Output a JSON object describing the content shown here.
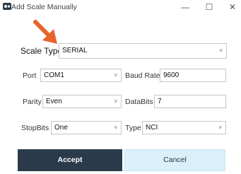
{
  "window": {
    "title": "Add Scale Manually",
    "minimize_glyph": "—",
    "maximize_glyph": "☐",
    "close_glyph": "✕"
  },
  "scale_type": {
    "label": "Scale Type",
    "value": "SERIAL"
  },
  "port": {
    "label": "Port",
    "value": "COM1"
  },
  "baud_rate": {
    "label": "Baud Rate",
    "value": "9600"
  },
  "parity": {
    "label": "Parity",
    "value": "Even"
  },
  "data_bits": {
    "label": "DataBits",
    "value": "7"
  },
  "stop_bits": {
    "label": "StopBits",
    "value": "One"
  },
  "type": {
    "label": "Type",
    "value": "NCI"
  },
  "buttons": {
    "accept": "Accept",
    "cancel": "Cancel"
  },
  "icons": {
    "dropdown": "˅",
    "app": "scale-app-icon",
    "arrow": "orange-arrow-icon"
  },
  "colors": {
    "accent_arrow": "#e8642c",
    "accept_bg": "#2b3a4a",
    "cancel_bg": "#d9f0fa"
  }
}
